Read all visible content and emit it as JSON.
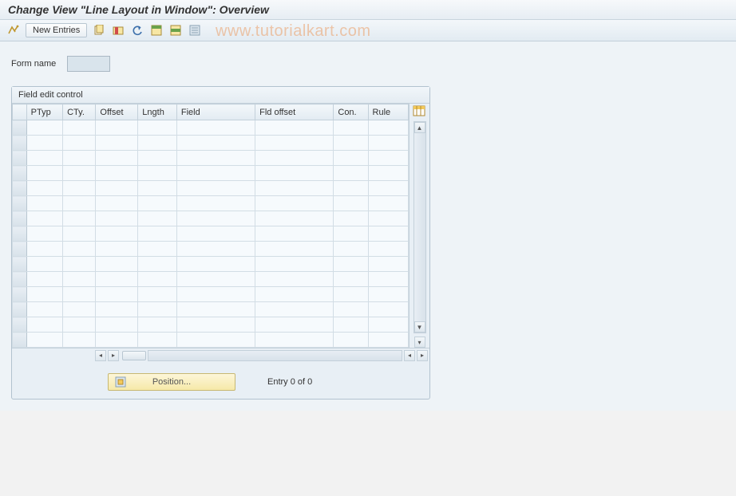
{
  "title": "Change View \"Line Layout in Window\": Overview",
  "watermark": "www.tutorialkart.com",
  "toolbar": {
    "new_entries_label": "New Entries"
  },
  "form": {
    "form_name_label": "Form name",
    "form_name_value": ""
  },
  "panel": {
    "title": "Field edit control",
    "columns": [
      "PTyp",
      "CTy.",
      "Offset",
      "Lngth",
      "Field",
      "Fld offset",
      "Con.",
      "Rule"
    ],
    "rows": 15
  },
  "footer": {
    "position_label": "Position...",
    "status": "Entry 0 of 0"
  }
}
